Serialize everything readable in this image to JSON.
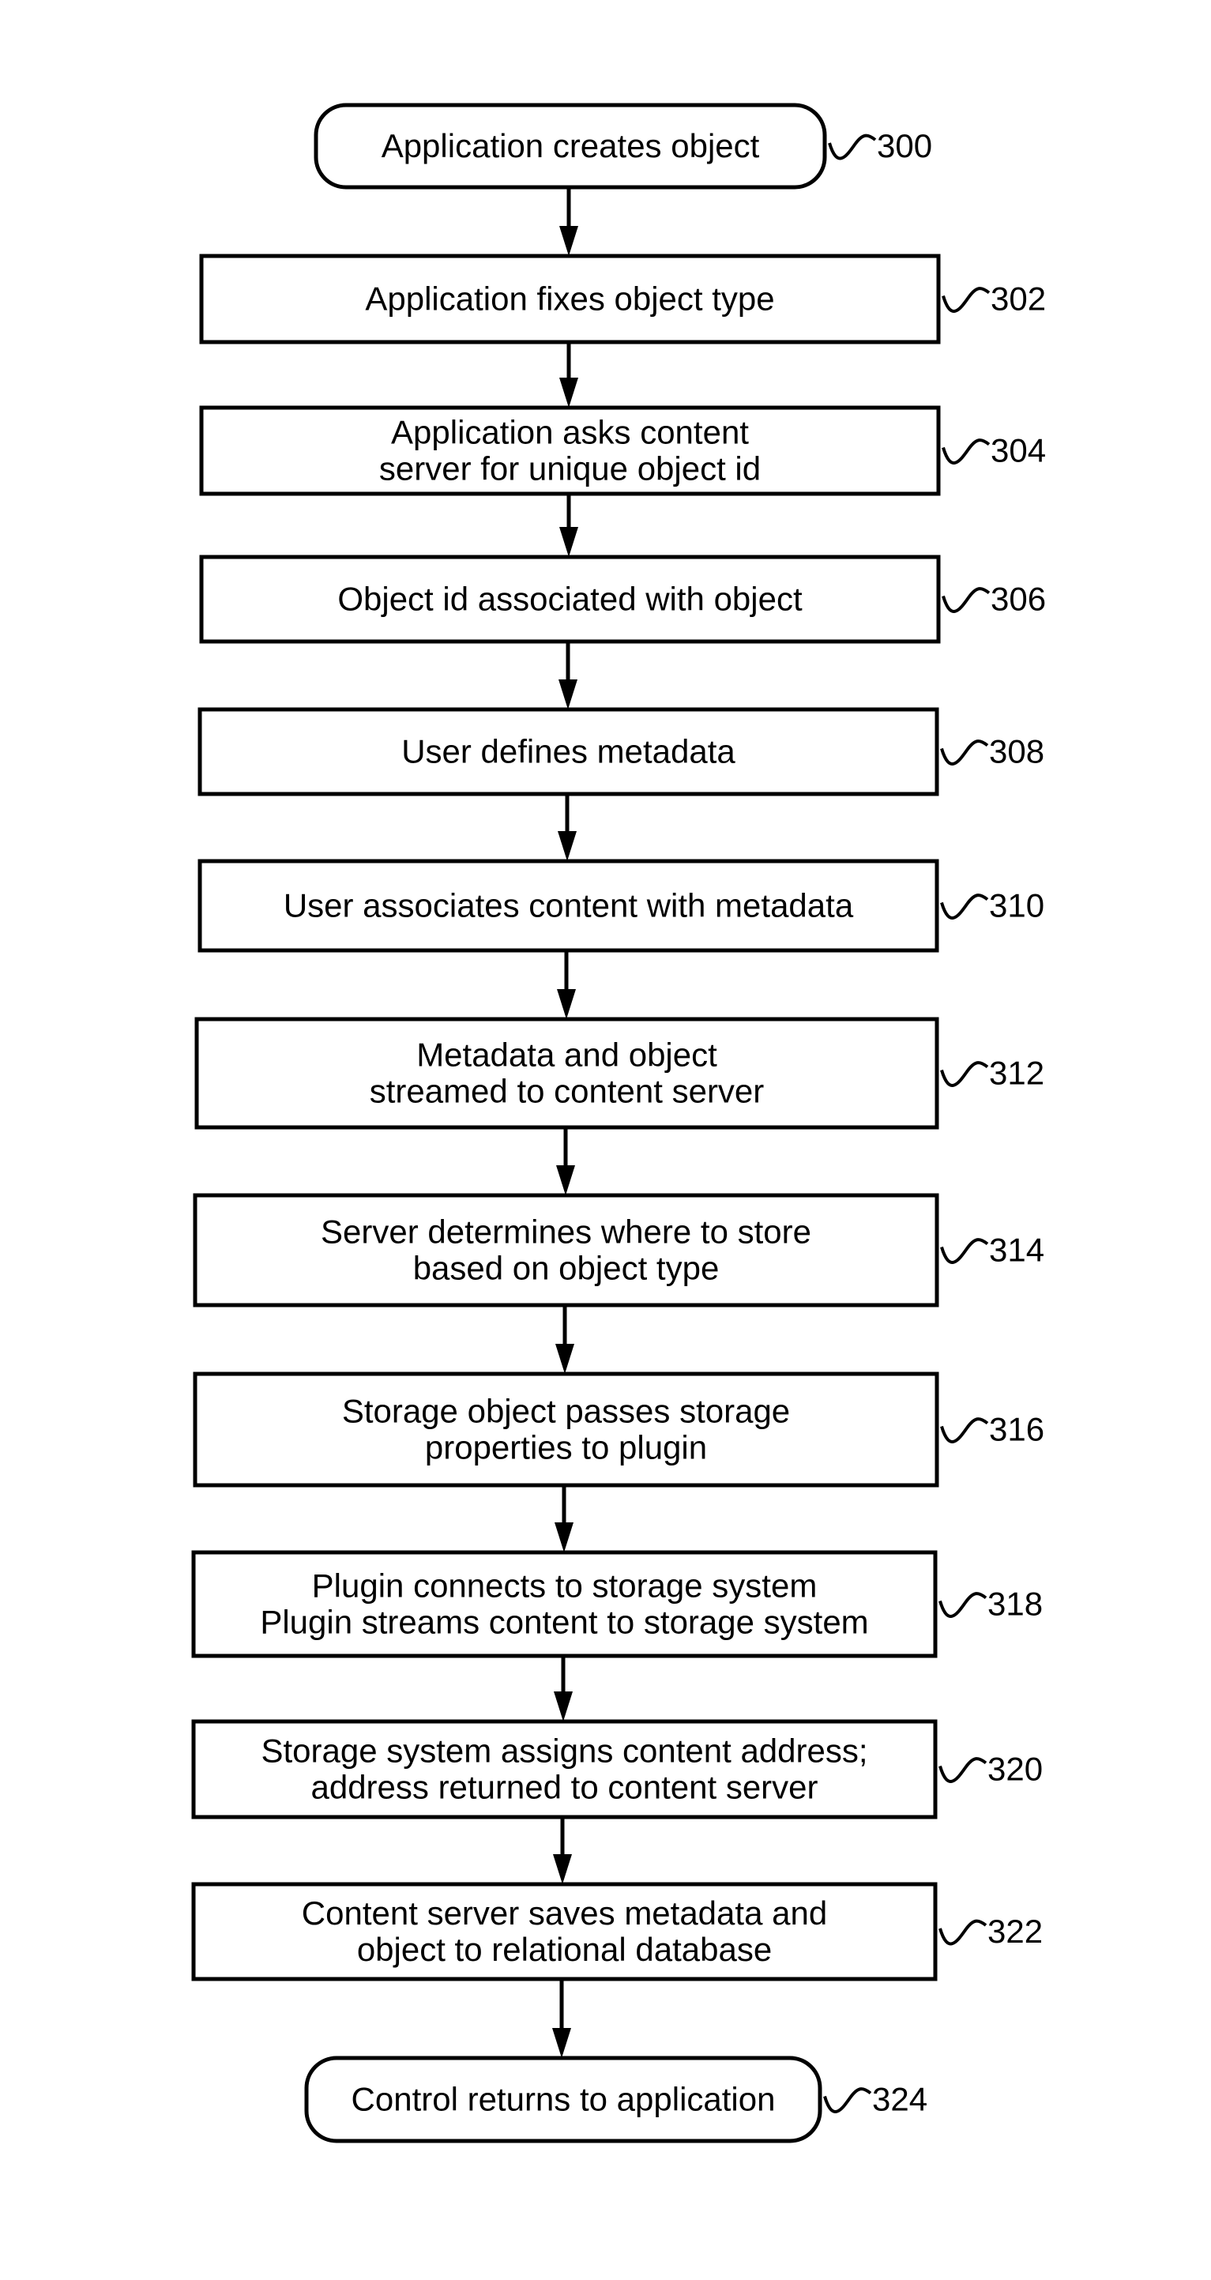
{
  "figure": {
    "type": "flowchart",
    "nodes": [
      {
        "id": "300",
        "shape": "terminal",
        "lines": [
          "Application creates object"
        ]
      },
      {
        "id": "302",
        "shape": "process",
        "lines": [
          "Application fixes object type"
        ]
      },
      {
        "id": "304",
        "shape": "process",
        "lines": [
          "Application asks content",
          "server for unique object id"
        ]
      },
      {
        "id": "306",
        "shape": "process",
        "lines": [
          "Object id associated with object"
        ]
      },
      {
        "id": "308",
        "shape": "process",
        "lines": [
          "User defines metadata"
        ]
      },
      {
        "id": "310",
        "shape": "process",
        "lines": [
          "User associates content with metadata"
        ]
      },
      {
        "id": "312",
        "shape": "process",
        "lines": [
          "Metadata and object",
          "streamed to content server"
        ]
      },
      {
        "id": "314",
        "shape": "process",
        "lines": [
          "Server determines where to store",
          "based on object type"
        ]
      },
      {
        "id": "316",
        "shape": "process",
        "lines": [
          "Storage object passes storage",
          "properties to plugin"
        ]
      },
      {
        "id": "318",
        "shape": "process",
        "lines": [
          "Plugin connects to storage system",
          "Plugin streams content to storage system"
        ]
      },
      {
        "id": "320",
        "shape": "process",
        "lines": [
          "Storage system assigns content address;",
          "address returned to content server"
        ]
      },
      {
        "id": "322",
        "shape": "process",
        "lines": [
          "Content server saves metadata and",
          "object to relational database"
        ]
      },
      {
        "id": "324",
        "shape": "terminal",
        "lines": [
          "Control returns to application"
        ]
      }
    ],
    "edges": [
      [
        "300",
        "302"
      ],
      [
        "302",
        "304"
      ],
      [
        "304",
        "306"
      ],
      [
        "306",
        "308"
      ],
      [
        "308",
        "310"
      ],
      [
        "310",
        "312"
      ],
      [
        "312",
        "314"
      ],
      [
        "314",
        "316"
      ],
      [
        "316",
        "318"
      ],
      [
        "318",
        "320"
      ],
      [
        "320",
        "322"
      ],
      [
        "322",
        "324"
      ]
    ]
  }
}
